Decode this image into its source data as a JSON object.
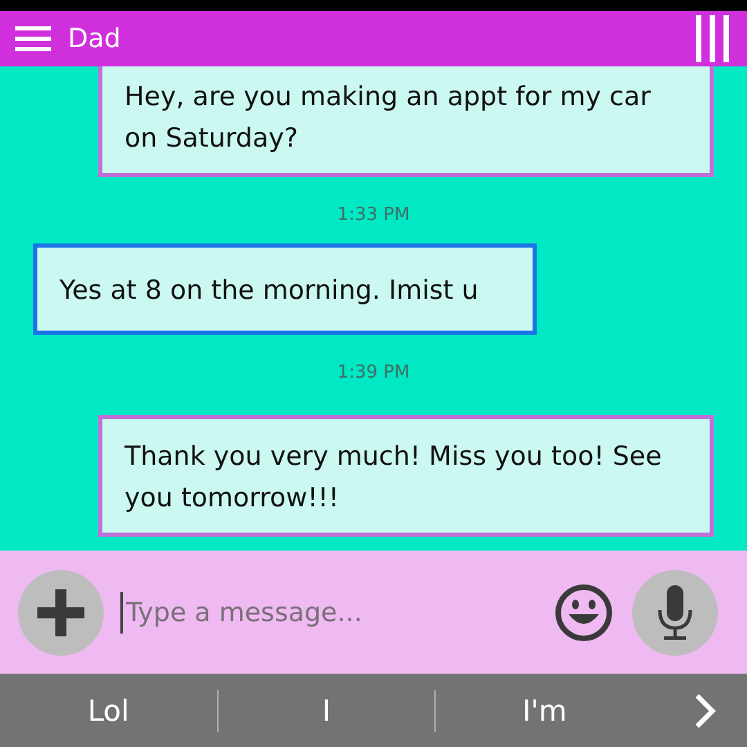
{
  "header": {
    "title": "Dad"
  },
  "messages": [
    {
      "kind": "sent",
      "text": "Hey, are you making an appt for my car on Saturday?"
    },
    {
      "kind": "time",
      "text": "1:33 PM"
    },
    {
      "kind": "received",
      "text": "Yes at 8 on the morning. Imist u"
    },
    {
      "kind": "time",
      "text": "1:39 PM"
    },
    {
      "kind": "sent",
      "text": "Thank you very much! Miss you too! See you tomorrow!!!"
    }
  ],
  "composer": {
    "placeholder": "Type a message..."
  },
  "suggestions": [
    "Lol",
    "I",
    "I'm"
  ]
}
